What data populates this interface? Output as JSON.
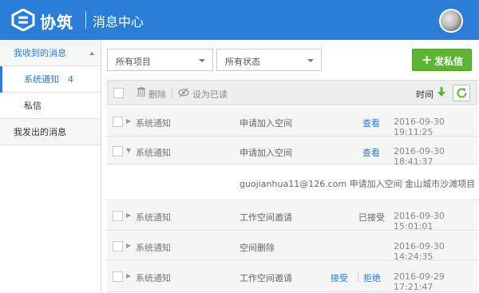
{
  "header": {
    "brand": "协筑",
    "title": "消息中心"
  },
  "sidebar": {
    "received": "我收到的消息",
    "system_notice": "系统通知",
    "system_notice_count": "4",
    "private": "私信",
    "sent": "我发出的消息"
  },
  "filters": {
    "project": "所有项目",
    "status": "所有状态"
  },
  "send_button": "发私信",
  "toolbar": {
    "delete": "删除",
    "mark_read": "设为已读",
    "time": "时间"
  },
  "colors": {
    "brand": "#2b7dd6",
    "send": "#5cb532"
  },
  "messages": [
    {
      "type": "系统通知",
      "title": "申请加入空间",
      "action": "查看",
      "time": "2016-09-30 19:11:25"
    },
    {
      "type": "系统通知",
      "title": "申请加入空间",
      "action": "查看",
      "time": "2016-09-30 18:41:37",
      "detail": "guojianhua11@126.com 申请加入空间 金山城市沙滩项目"
    },
    {
      "type": "系统通知",
      "title": "工作空间邀请",
      "status": "已接受",
      "time": "2016-09-30 15:01:01"
    },
    {
      "type": "系统通知",
      "title": "空间删除",
      "time": "2016-09-30 14:24:35"
    },
    {
      "type": "系统通知",
      "title": "工作空间邀请",
      "accept": "接受",
      "reject": "拒绝",
      "time": "2016-09-29 17:21:47"
    }
  ]
}
